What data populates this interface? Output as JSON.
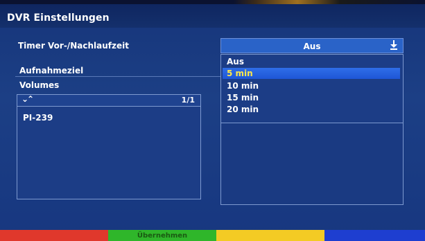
{
  "title": "DVR Einstellungen",
  "labels": {
    "timer": "Timer Vor-/Nachlaufzeit",
    "aufnahmeziel": "Aufnahmeziel",
    "volumes": "Volumes"
  },
  "volume_list": {
    "nav": "⌄⌃",
    "page": "1/1",
    "items": [
      "PI-239"
    ]
  },
  "dropdown": {
    "current_value": "Aus",
    "arrow_icon": "download-arrow-icon",
    "options": [
      "Aus",
      "5 min",
      "10 min",
      "15 min",
      "20 min"
    ],
    "selected_index": 1
  },
  "color_buttons": {
    "red": "",
    "green": "Übernehmen",
    "yellow": "",
    "blue": ""
  },
  "colors": {
    "background": "#1c3f85",
    "highlight": "#2f6ee8",
    "selected_text": "#ffe84a",
    "red": "#e0382c",
    "green": "#2fb62a",
    "yellow": "#f3cb24",
    "blue": "#1e3ed0"
  }
}
